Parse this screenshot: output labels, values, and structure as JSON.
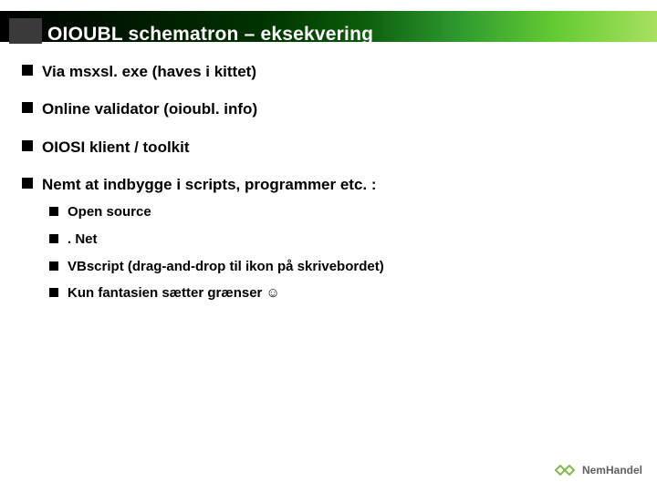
{
  "slide": {
    "title": "OIOUBL schematron – eksekvering"
  },
  "bullets": {
    "items": [
      {
        "text": "Via msxsl. exe (haves i kittet)"
      },
      {
        "text": "Online validator (oioubl. info)"
      },
      {
        "text": "OIOSI klient / toolkit"
      },
      {
        "text": "Nemt at indbygge i scripts, programmer etc. :",
        "children": [
          {
            "text": "Open source"
          },
          {
            "text": ". Net"
          },
          {
            "text": "VBscript (drag-and-drop til ikon på skrivebordet)"
          },
          {
            "text": "Kun fantasien sætter grænser ☺"
          }
        ]
      }
    ]
  },
  "footer": {
    "brand_main": "NemHandel",
    "brand_sub": ""
  }
}
